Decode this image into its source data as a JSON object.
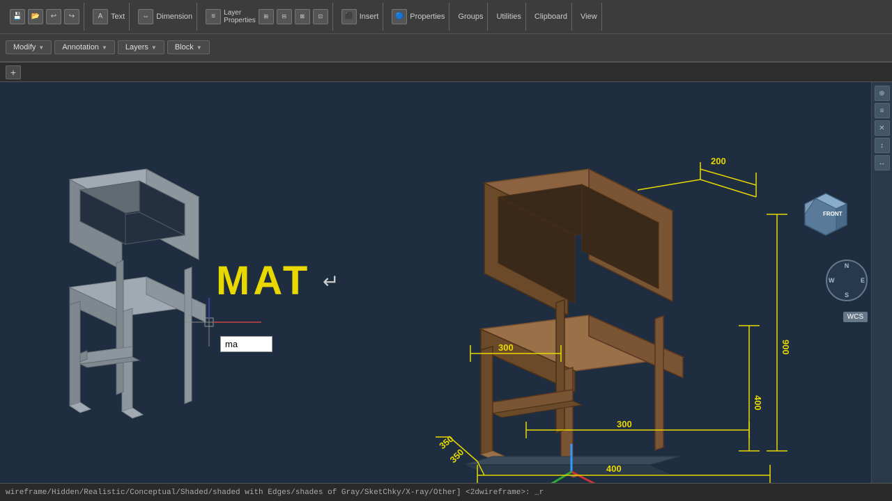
{
  "toolbar": {
    "row1": {
      "groups": [
        {
          "id": "file",
          "buttons": [
            "save",
            "open"
          ]
        },
        {
          "id": "text",
          "label": "Text"
        },
        {
          "id": "dimension",
          "label": "Dimension"
        },
        {
          "id": "layer",
          "label": "Layer\nProperties"
        },
        {
          "id": "insert",
          "label": "Insert"
        },
        {
          "id": "properties",
          "label": "Properties"
        },
        {
          "id": "groups",
          "label": "Groups"
        },
        {
          "id": "utilities",
          "label": "Utilities"
        },
        {
          "id": "clipboard",
          "label": "Clipboard"
        },
        {
          "id": "view",
          "label": "View"
        }
      ]
    },
    "row2": {
      "dropdowns": [
        {
          "id": "modify",
          "label": "Modify"
        },
        {
          "id": "annotation",
          "label": "Annotation"
        },
        {
          "id": "layers",
          "label": "Layers"
        },
        {
          "id": "block",
          "label": "Block"
        }
      ]
    }
  },
  "tabbar": {
    "plus_label": "+",
    "tab_label": ""
  },
  "canvas": {
    "mat_text": "MAT",
    "cmd_input_value": "ma",
    "dimensions": {
      "d200": "200",
      "d900": "900",
      "d300_left": "300",
      "d300_center": "300",
      "d400": "400",
      "d350": "350",
      "d400_bottom": "400"
    }
  },
  "viewcube": {
    "front_label": "FRONT",
    "compass_n": "N",
    "compass_s": "S",
    "compass_w": "W",
    "compass_e": "E",
    "wcs_label": "WCS"
  },
  "statusbar": {
    "text": "wireframe/Hidden/Realistic/Conceptual/Shaded/shaded with Edges/shades of Gray/SketChky/X-ray/Other] <2dwireframe>: _r"
  }
}
